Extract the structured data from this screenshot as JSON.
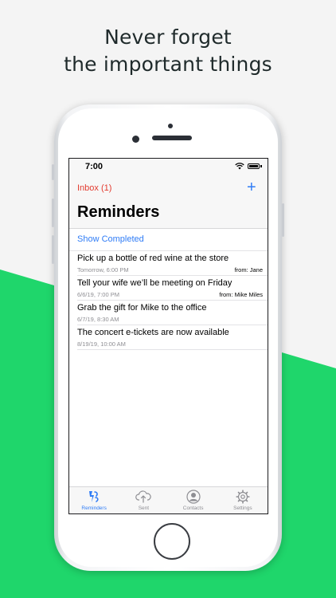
{
  "headline": {
    "line1": "Never forget",
    "line2": "the important things"
  },
  "colors": {
    "background": "#f4f4f4",
    "green": "#1fd66b",
    "accent_blue": "#2f7cf6",
    "accent_red": "#e33b2f"
  },
  "status_bar": {
    "time": "7:00",
    "icons": [
      "wifi-icon",
      "battery-icon"
    ]
  },
  "nav": {
    "back_label": "Inbox (1)",
    "add_icon": "plus-icon",
    "add_label": "+",
    "title": "Reminders"
  },
  "show_completed_label": "Show Completed",
  "reminders": [
    {
      "title": "Pick up a bottle of red wine at the store",
      "date": "Tomorrow, 6:00 PM",
      "from": "from: Jane"
    },
    {
      "title": "Tell your wife we’ll be meeting on Friday",
      "date": "6/6/19, 7:00 PM",
      "from": "from: Mike Miles"
    },
    {
      "title": "Grab the gift for Mike to the office",
      "date": "6/7/19, 8:30 AM",
      "from": ""
    },
    {
      "title": "The concert e-tickets are now available",
      "date": "8/19/19, 10:00 AM",
      "from": ""
    }
  ],
  "tabs": [
    {
      "label": "Reminders",
      "icon": "reminders-icon",
      "active": true
    },
    {
      "label": "Sent",
      "icon": "cloud-upload-icon",
      "active": false
    },
    {
      "label": "Contacts",
      "icon": "person-icon",
      "active": false
    },
    {
      "label": "Settings",
      "icon": "gear-icon",
      "active": false
    }
  ]
}
